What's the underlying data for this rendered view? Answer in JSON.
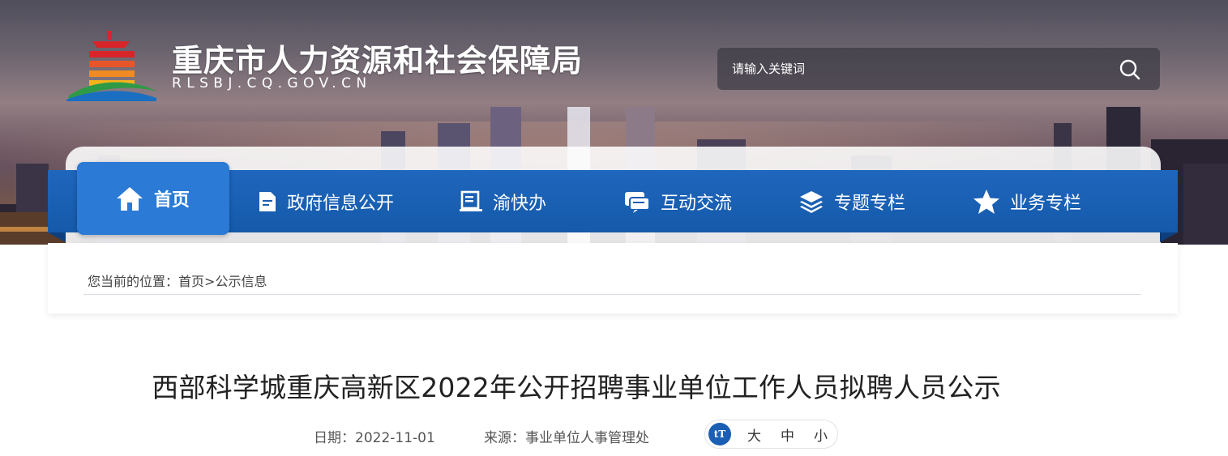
{
  "header": {
    "site_title": "重庆市人力资源和社会保障局",
    "site_domain": "RLSBJ.CQ.GOV.CN",
    "search": {
      "placeholder": "请输入关键词"
    }
  },
  "nav": {
    "items": [
      {
        "label": "首页",
        "icon": "home-icon",
        "active": true
      },
      {
        "label": "政府信息公开",
        "icon": "document-icon"
      },
      {
        "label": "渝快办",
        "icon": "book-icon"
      },
      {
        "label": "互动交流",
        "icon": "chat-icon"
      },
      {
        "label": "专题专栏",
        "icon": "layers-icon"
      },
      {
        "label": "业务专栏",
        "icon": "star-icon"
      }
    ]
  },
  "breadcrumb": {
    "prefix": "您当前的位置：",
    "home": "首页",
    "separator": ">",
    "current": "公示信息"
  },
  "article": {
    "title": "西部科学城重庆高新区2022年公开招聘事业单位工作人员拟聘人员公示",
    "date_label": "日期：",
    "date": "2022-11-01",
    "source_label": "来源：",
    "source": "事业单位人事管理处"
  },
  "font_size": {
    "icon_text": "tT",
    "large": "大",
    "medium": "中",
    "small": "小"
  },
  "colors": {
    "nav_blue": "#1a5fb4",
    "nav_active": "#2a7ad6"
  }
}
